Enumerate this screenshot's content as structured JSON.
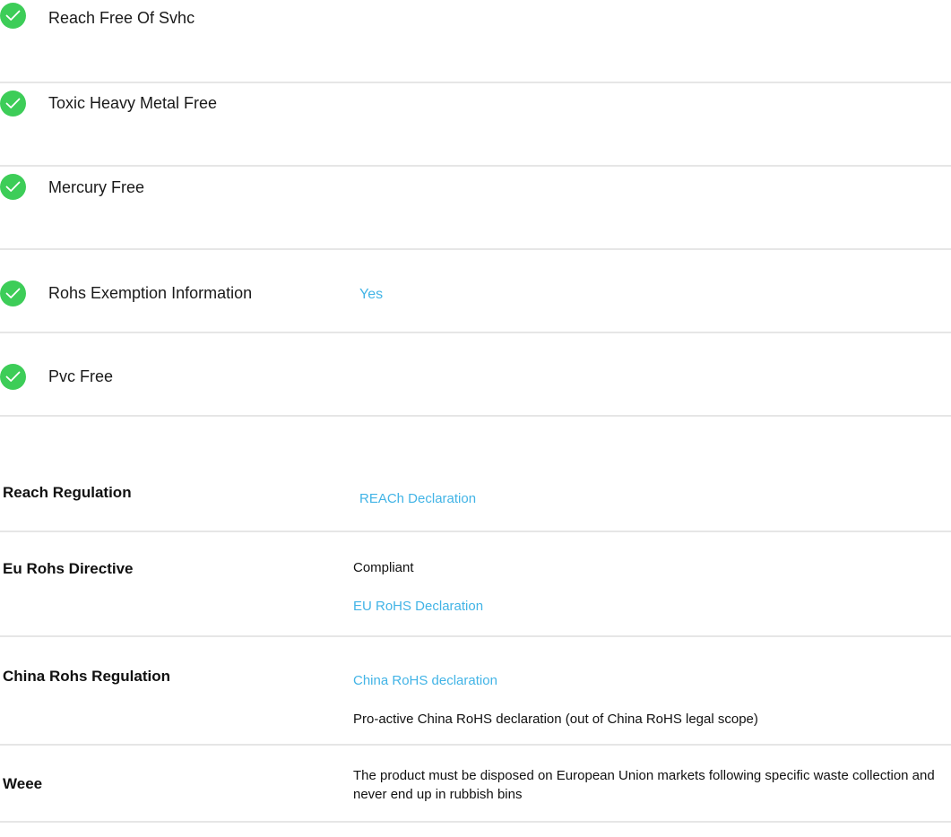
{
  "colors": {
    "check_green": "#3dcd58",
    "link_blue": "#42b4e6",
    "divider": "#e6e6e6",
    "text": "#111111"
  },
  "environmental": [
    {
      "icon": "check-circle-icon",
      "label": "Reach Free Of Svhc",
      "value": ""
    },
    {
      "icon": "check-circle-icon",
      "label": "Toxic Heavy Metal Free",
      "value": ""
    },
    {
      "icon": "check-circle-icon",
      "label": "Mercury Free",
      "value": ""
    },
    {
      "icon": "check-circle-icon",
      "label": "Rohs Exemption Information",
      "value": "Yes"
    },
    {
      "icon": "check-circle-icon",
      "label": "Pvc Free",
      "value": ""
    }
  ],
  "regulations": [
    {
      "label": "Reach Regulation",
      "items": [
        {
          "text": "REACh Declaration",
          "kind": "link"
        }
      ]
    },
    {
      "label": "Eu Rohs Directive",
      "items": [
        {
          "text": "Compliant",
          "kind": "text"
        },
        {
          "text": "EU RoHS Declaration",
          "kind": "link"
        }
      ]
    },
    {
      "label": "China Rohs Regulation",
      "items": [
        {
          "text": "China RoHS declaration",
          "kind": "link"
        },
        {
          "text": "Pro-active China RoHS declaration (out of China RoHS legal scope)",
          "kind": "text"
        }
      ]
    },
    {
      "label": "Weee",
      "items": [
        {
          "text": "The product must be disposed on European Union markets following specific waste collection and never end up in rubbish bins",
          "kind": "text"
        }
      ]
    }
  ]
}
